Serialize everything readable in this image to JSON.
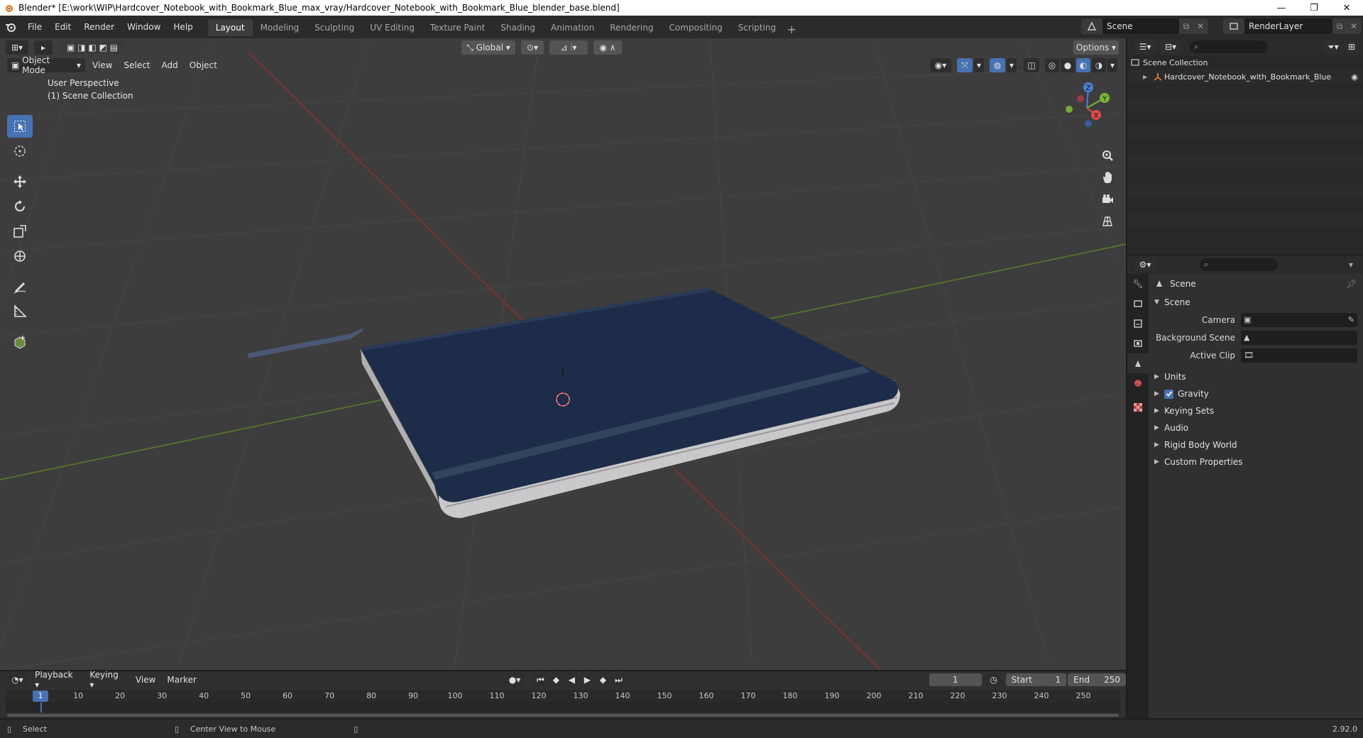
{
  "window": {
    "title": "Blender* [E:\\work\\WIP\\Hardcover_Notebook_with_Bookmark_Blue_max_vray/Hardcover_Notebook_with_Bookmark_Blue_blender_base.blend]"
  },
  "menu": {
    "items": [
      "File",
      "Edit",
      "Render",
      "Window",
      "Help"
    ]
  },
  "workspaces": [
    "Layout",
    "Modeling",
    "Sculpting",
    "UV Editing",
    "Texture Paint",
    "Shading",
    "Animation",
    "Rendering",
    "Compositing",
    "Scripting"
  ],
  "scene_selector": {
    "value": "Scene"
  },
  "renderlayer_selector": {
    "value": "RenderLayer"
  },
  "viewport": {
    "transform_orientation": "Global",
    "options_label": "Options",
    "mode": "Object Mode",
    "header_menus": [
      "View",
      "Select",
      "Add",
      "Object"
    ],
    "info_line1": "User Perspective",
    "info_line2": "(1) Scene Collection",
    "gizmo": {
      "x": "X",
      "y": "Y",
      "z": "Z"
    }
  },
  "outliner": {
    "collection": "Scene Collection",
    "object": "Hardcover_Notebook_with_Bookmark_Blue"
  },
  "properties": {
    "title": "Scene",
    "section": "Scene",
    "fields": {
      "camera_label": "Camera",
      "background_label": "Background Scene",
      "active_clip_label": "Active Clip"
    },
    "sections": [
      "Units",
      "Gravity",
      "Keying Sets",
      "Audio",
      "Rigid Body World",
      "Custom Properties"
    ]
  },
  "timeline": {
    "menus": [
      "Playback",
      "Keying",
      "View",
      "Marker"
    ],
    "current_frame": "1",
    "start_label": "Start",
    "start_value": "1",
    "end_label": "End",
    "end_value": "250",
    "ruler": [
      "1",
      "10",
      "20",
      "30",
      "40",
      "50",
      "60",
      "70",
      "80",
      "90",
      "100",
      "110",
      "120",
      "130",
      "140",
      "150",
      "160",
      "170",
      "180",
      "190",
      "200",
      "210",
      "220",
      "230",
      "240",
      "250"
    ]
  },
  "statusbar": {
    "select": "Select",
    "center_view": "Center View to Mouse",
    "version": "2.92.0"
  },
  "colors": {
    "accent": "#4772b3",
    "x_axis": "#c43a3a",
    "y_axis": "#6b9e2a",
    "notebook": "#1d2c48"
  }
}
